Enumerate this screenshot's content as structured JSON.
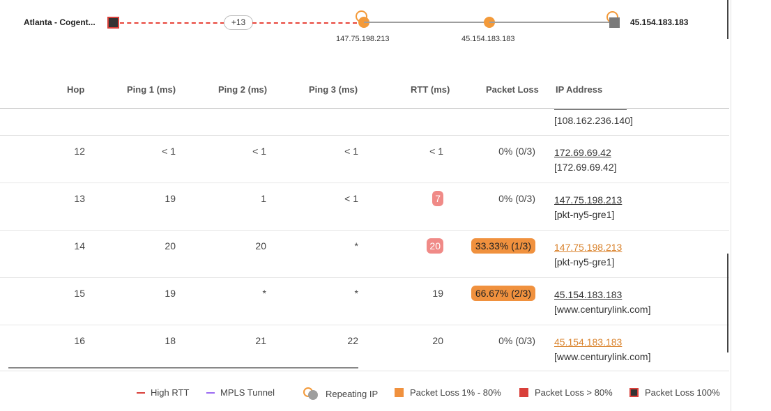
{
  "path": {
    "source_label": "Atlanta - Cogent...",
    "hidden_hops": "+13",
    "nodes": [
      {
        "label": "147.75.198.213"
      },
      {
        "label": "45.154.183.183"
      }
    ],
    "destination_label": "45.154.183.183"
  },
  "colors": {
    "high_rtt": "#e8443a",
    "mpls": "#9b6bf2",
    "packet_loss_mid": "#f0913e",
    "packet_loss_high": "#d9403a",
    "repeating_ring": "#f39a3a",
    "rtt_badge": "#f08a87"
  },
  "table": {
    "headers": {
      "hop": "Hop",
      "ping1": "Ping 1 (ms)",
      "ping2": "Ping 2 (ms)",
      "ping3": "Ping 3 (ms)",
      "rtt": "RTT (ms)",
      "packet_loss": "Packet Loss",
      "ip": "IP Address"
    },
    "partial_row": {
      "ip_sub": "[108.162.236.140]"
    },
    "rows": [
      {
        "hop": "12",
        "ping1": "< 1",
        "ping2": "< 1",
        "ping3": "< 1",
        "rtt": "< 1",
        "packet_loss": "0% (0/3)",
        "ip": "172.69.69.42",
        "ip_sub": "[172.69.69.42]"
      },
      {
        "hop": "13",
        "ping1": "19",
        "ping2": "1",
        "ping3": "< 1",
        "rtt": "7",
        "packet_loss": "0% (0/3)",
        "ip": "147.75.198.213",
        "ip_sub": "[pkt-ny5-gre1]"
      },
      {
        "hop": "14",
        "ping1": "20",
        "ping2": "20",
        "ping3": "*",
        "rtt": "20",
        "packet_loss": "33.33% (1/3)",
        "ip": "147.75.198.213",
        "ip_sub": "[pkt-ny5-gre1]"
      },
      {
        "hop": "15",
        "ping1": "19",
        "ping2": "*",
        "ping3": "*",
        "rtt": "19",
        "packet_loss": "66.67% (2/3)",
        "ip": "45.154.183.183",
        "ip_sub": "[www.centurylink.com]"
      },
      {
        "hop": "16",
        "ping1": "18",
        "ping2": "21",
        "ping3": "22",
        "rtt": "20",
        "packet_loss": "0% (0/3)",
        "ip": "45.154.183.183",
        "ip_sub": "[www.centurylink.com]"
      }
    ]
  },
  "legend": {
    "high_rtt": "High RTT",
    "mpls": "MPLS Tunnel",
    "repeating_ip": "Repeating IP",
    "loss_mid": "Packet Loss 1% - 80%",
    "loss_high": "Packet Loss > 80%",
    "loss_full": "Packet Loss 100%"
  }
}
